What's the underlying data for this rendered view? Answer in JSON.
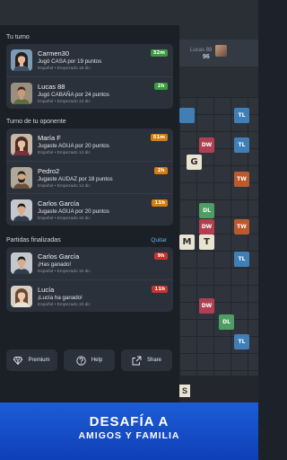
{
  "board": {
    "opponent_name": "Lucas 88",
    "opponent_score": "96",
    "rack_tile": "S",
    "squares": [
      {
        "type": "tl",
        "label": "TL"
      },
      {
        "type": "tl",
        "label": ""
      },
      {
        "type": "tile",
        "label": "G"
      },
      {
        "type": "dw",
        "label": "DW"
      },
      {
        "type": "tw",
        "label": "TW"
      },
      {
        "type": "tl",
        "label": "TL"
      },
      {
        "type": "dl",
        "label": "DL"
      },
      {
        "type": "dw",
        "label": "DW"
      },
      {
        "type": "tile",
        "label": "M"
      },
      {
        "type": "tile",
        "label": "T"
      },
      {
        "type": "tl",
        "label": "TL"
      },
      {
        "type": "tw",
        "label": "TW"
      },
      {
        "type": "dw",
        "label": "DW"
      },
      {
        "type": "dl",
        "label": "DL"
      },
      {
        "type": "tl",
        "label": "TL"
      }
    ]
  },
  "sections": {
    "your_turn": "Tu turno",
    "opponent_turn": "Turno de tu oponente",
    "finished": "Partidas finalizadas",
    "quit": "Quitar"
  },
  "your_turn_games": [
    {
      "name": "Carmen30",
      "message": "Jugó CASA por 19 puntos",
      "meta": "Español • Empezado 18 dic",
      "badge": "32m",
      "badge_color": "green",
      "avatar": "woman-dark-hair"
    },
    {
      "name": "Lucas 88",
      "message": "Jugó CABAÑA por 24 puntos",
      "meta": "Español • Empezado 13 dic",
      "badge": "2h",
      "badge_color": "green",
      "avatar": "man-curly"
    }
  ],
  "opponent_turn_games": [
    {
      "name": "María F",
      "message": "Jugaste AGUA por 20 puntos",
      "meta": "Español • Empezado 14 dic",
      "badge": "51m",
      "badge_color": "orange",
      "avatar": "woman-long-hair"
    },
    {
      "name": "Pedro2",
      "message": "Jugaste AUDAZ por 18 puntos",
      "meta": "Español • Empezado 14 dic",
      "badge": "2h",
      "badge_color": "orange",
      "avatar": "man-beard"
    },
    {
      "name": "Carlos García",
      "message": "Jugaste AGUA por 20 puntos",
      "meta": "Español • Empezado 10 dic",
      "badge": "11h",
      "badge_color": "orange",
      "avatar": "man-short-hair"
    }
  ],
  "finished_games": [
    {
      "name": "Carlos García",
      "message": "¡Has ganado!",
      "meta": "Español • Empezado 10 dic",
      "badge": "9h",
      "badge_color": "red",
      "avatar": "man-short-hair"
    },
    {
      "name": "Lucía",
      "message": "¡Lucía ha ganado!",
      "meta": "Español • Empezado 10 dic",
      "badge": "11h",
      "badge_color": "red",
      "avatar": "woman-light-hair"
    }
  ],
  "footer_buttons": [
    {
      "label": "Premium",
      "icon": "diamond-icon"
    },
    {
      "label": "Help",
      "icon": "question-icon"
    },
    {
      "label": "Share",
      "icon": "share-icon"
    }
  ],
  "promo": {
    "line1": "DESAFÍA A",
    "line2": "AMIGOS Y FAMILIA"
  },
  "colors": {
    "badge_green": "#3b9b3f",
    "badge_orange": "#d57d12",
    "badge_red": "#c6342a",
    "promo_blue": "#1b5dd6",
    "link_blue": "#67b6ea"
  }
}
